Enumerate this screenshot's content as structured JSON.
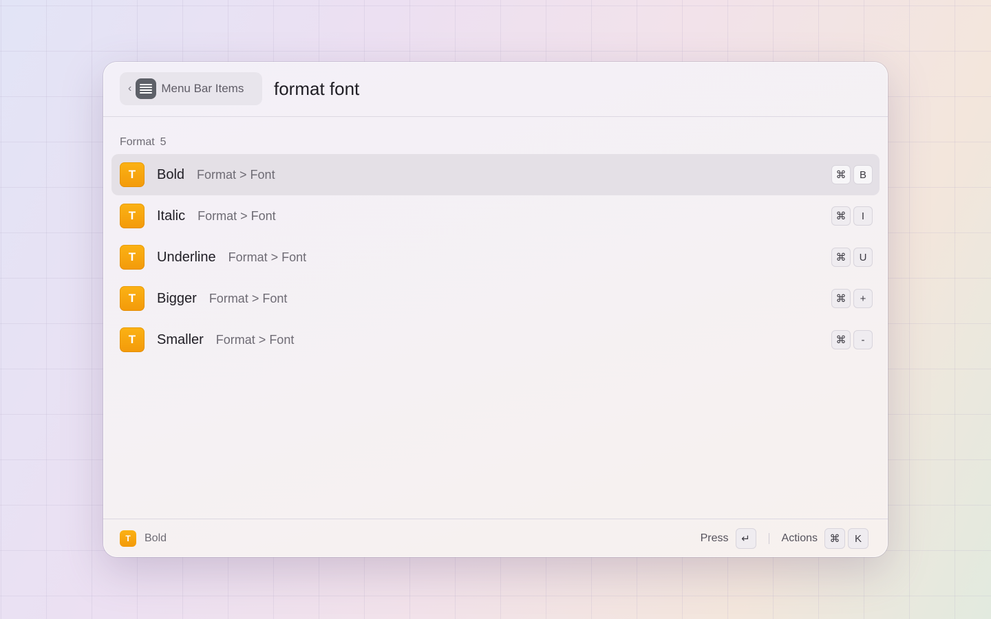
{
  "header": {
    "back_chevron": "‹",
    "back_icon": "menu-list-icon",
    "back_label": "Menu Bar Items",
    "search_query": "format font"
  },
  "section": {
    "title": "Format",
    "count": "5"
  },
  "items": [
    {
      "icon_letter": "T",
      "title": "Bold",
      "subtitle": "Format > Font",
      "keys": [
        "⌘",
        "B"
      ],
      "selected": true
    },
    {
      "icon_letter": "T",
      "title": "Italic",
      "subtitle": "Format > Font",
      "keys": [
        "⌘",
        "I"
      ],
      "selected": false
    },
    {
      "icon_letter": "T",
      "title": "Underline",
      "subtitle": "Format > Font",
      "keys": [
        "⌘",
        "U"
      ],
      "selected": false
    },
    {
      "icon_letter": "T",
      "title": "Bigger",
      "subtitle": "Format > Font",
      "keys": [
        "⌘",
        "+"
      ],
      "selected": false
    },
    {
      "icon_letter": "T",
      "title": "Smaller",
      "subtitle": "Format > Font",
      "keys": [
        "⌘",
        "-"
      ],
      "selected": false
    }
  ],
  "footer": {
    "icon_letter": "T",
    "selected_label": "Bold",
    "press_label": "Press",
    "enter_key": "↵",
    "actions_label": "Actions",
    "actions_keys": [
      "⌘",
      "K"
    ]
  },
  "colors": {
    "icon_accent": "#f5a30c",
    "selected_row": "#e4e0e6"
  }
}
